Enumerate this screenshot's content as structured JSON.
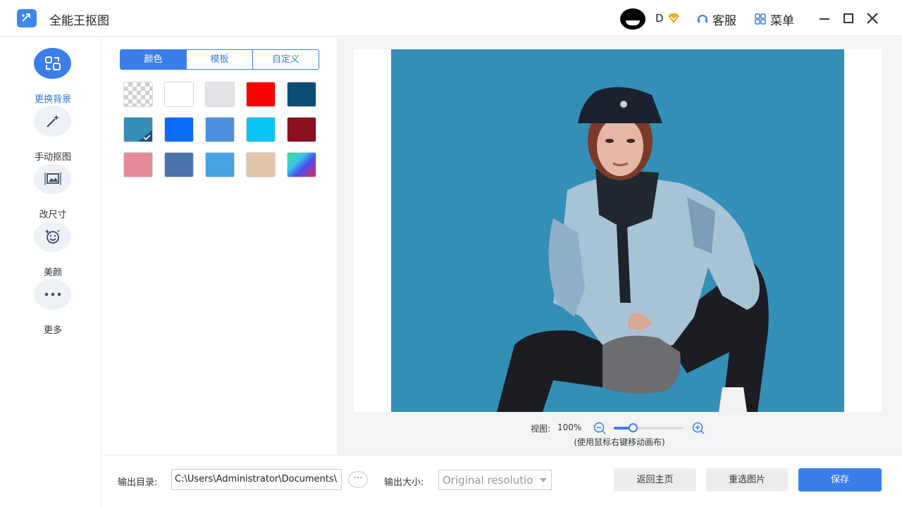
{
  "titlebar": {
    "app_title": "全能王抠图",
    "user_name": "D",
    "service_label": "客服",
    "menu_label": "菜单"
  },
  "sidebar": {
    "items": [
      {
        "label": "更换背景",
        "icon": "swap-background-icon",
        "active": true
      },
      {
        "label": "手动抠图",
        "icon": "magic-wand-icon",
        "active": false
      },
      {
        "label": "改尺寸",
        "icon": "resize-image-icon",
        "active": false
      },
      {
        "label": "美颜",
        "icon": "beauty-face-icon",
        "active": false
      },
      {
        "label": "更多",
        "icon": "more-dots-icon",
        "active": false
      }
    ]
  },
  "panel": {
    "tabs": [
      {
        "label": "颜色",
        "active": true
      },
      {
        "label": "模板",
        "active": false
      },
      {
        "label": "自定义",
        "active": false
      }
    ],
    "swatches": [
      {
        "type": "transparent",
        "color": "transparent"
      },
      {
        "type": "solid",
        "color": "#ffffff"
      },
      {
        "type": "solid",
        "color": "#e2e3e7"
      },
      {
        "type": "solid",
        "color": "#fb0103"
      },
      {
        "type": "solid",
        "color": "#0c4e73"
      },
      {
        "type": "solid",
        "color": "#348fb6",
        "selected": true
      },
      {
        "type": "solid",
        "color": "#0a6cfb"
      },
      {
        "type": "solid",
        "color": "#4a90dd"
      },
      {
        "type": "solid",
        "color": "#08c3f3"
      },
      {
        "type": "solid",
        "color": "#8b0f1e"
      },
      {
        "type": "solid",
        "color": "#e48b97"
      },
      {
        "type": "solid",
        "color": "#4a72ab"
      },
      {
        "type": "solid",
        "color": "#46a2e3"
      },
      {
        "type": "solid",
        "color": "#e3c4a8"
      },
      {
        "type": "gradient",
        "color": "gradient"
      }
    ]
  },
  "preview": {
    "background_color": "#348fb6",
    "zoom_label": "视图:",
    "zoom_value": "100%",
    "zoom_fraction": 0.27,
    "hint": "(使用鼠标右键移动画布)"
  },
  "bottom": {
    "output_dir_label": "输出目录:",
    "output_dir_value": "C:\\Users\\Administrator\\Documents\\",
    "browse_label": "···",
    "output_size_label": "输出大小:",
    "output_size_value": "Original resolutio",
    "home_label": "返回主页",
    "reselect_label": "重选图片",
    "save_label": "保存"
  },
  "colors": {
    "accent": "#3b7ee9",
    "vip": "#f5a623"
  }
}
